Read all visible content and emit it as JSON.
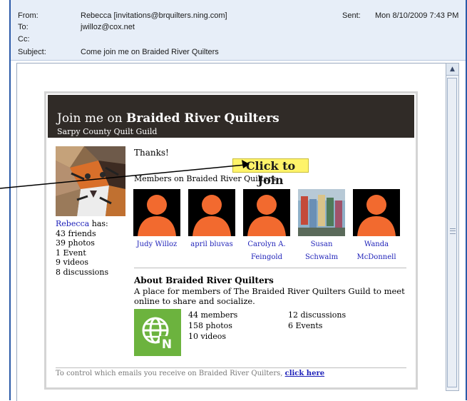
{
  "header": {
    "from_label": "From:",
    "from_value": "Rebecca [invitations@brquilters.ning.com]",
    "to_label": "To:",
    "to_value": "jwilloz@cox.net",
    "cc_label": "Cc:",
    "cc_value": "",
    "subject_label": "Subject:",
    "subject_value": "Come join me on Braided River Quilters",
    "sent_label": "Sent:",
    "sent_value": "Mon 8/10/2009 7:43 PM"
  },
  "banner": {
    "title_prefix": "Join me on",
    "title_network": "Braided River Quilters",
    "subtitle": "Sarpy County Quilt Guild"
  },
  "sender": {
    "name": "Rebecca",
    "has": " has:",
    "stats": [
      "43 friends",
      "39 photos",
      "1 Event",
      "9 videos",
      "8 discussions"
    ]
  },
  "message": {
    "thanks": "Thanks!",
    "join_button": "Click to Join",
    "members_label": "Members on Braided River Quilters:"
  },
  "members": [
    {
      "name_line1": "Judy Willoz",
      "name_line2": ""
    },
    {
      "name_line1": "april bluvas",
      "name_line2": ""
    },
    {
      "name_line1": "Carolyn A.",
      "name_line2": "Feingold"
    },
    {
      "name_line1": "Susan",
      "name_line2": "Schwalm"
    },
    {
      "name_line1": "Wanda",
      "name_line2": "McDonnell"
    }
  ],
  "about": {
    "title": "About Braided River Quilters",
    "description": "A place for members of The Braided River Quilters Guild to meet online to share and socialize.",
    "members": "44 members",
    "photos": "158 photos",
    "videos": "10 videos",
    "discussions": "12 discussions",
    "events": "6 Events"
  },
  "footer": {
    "text": "To control which emails you receive on Braided River Quilters, ",
    "link": "click here"
  },
  "colors": {
    "banner_bg": "#302b27",
    "link": "#1c1fb8",
    "join_highlight": "#fef36a",
    "placeholder_orange": "#f26a2f",
    "logo_green": "#6cb33e"
  }
}
